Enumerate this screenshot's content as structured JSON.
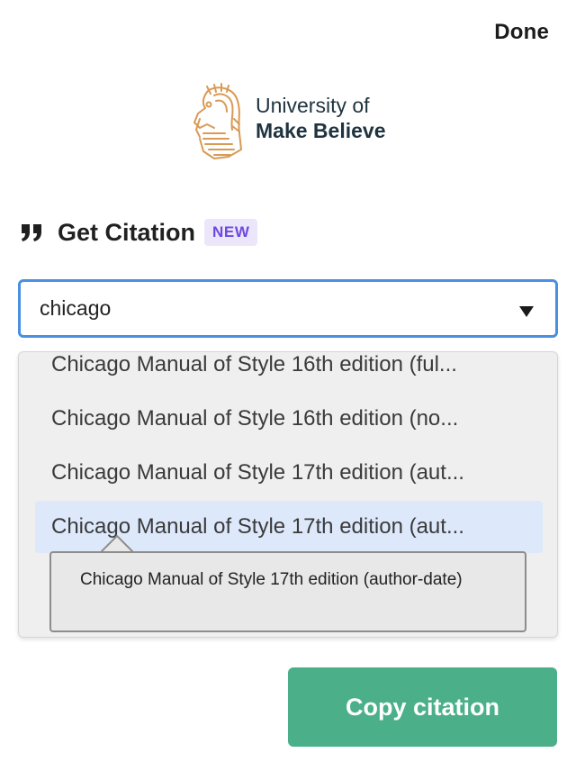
{
  "header": {
    "done_label": "Done"
  },
  "logo": {
    "line1": "University of",
    "line2": "Make Believe",
    "color": "#d99a55"
  },
  "citation": {
    "title": "Get Citation",
    "badge": "NEW",
    "icon": "quote-icon"
  },
  "select": {
    "value": "chicago",
    "caret_icon": "caret-down-icon"
  },
  "dropdown": {
    "options": [
      "Chicago Manual of Style 16th edition (ful...",
      "Chicago Manual of Style 16th edition (no...",
      "Chicago Manual of Style 17th edition (aut...",
      "Chicago Manual of Style 17th edition (aut..."
    ],
    "selected_index": 3
  },
  "tooltip": {
    "text": "Chicago Manual of Style 17th edition (author-date)"
  },
  "actions": {
    "copy_label": "Copy citation"
  },
  "colors": {
    "accent_blue": "#4a90e2",
    "button_green": "#4bb08a",
    "badge_bg": "#ece6fb",
    "badge_text": "#6d48e0",
    "selected_bg": "#dde9fb"
  }
}
